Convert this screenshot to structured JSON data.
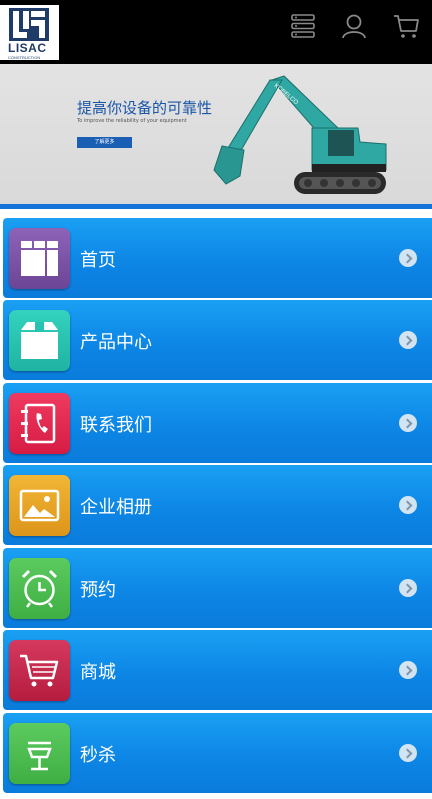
{
  "logo": {
    "name": "LISAC",
    "sub": "CONSTRUCTION"
  },
  "header_icons": [
    "list-icon",
    "user-icon",
    "cart-icon"
  ],
  "banner": {
    "title": "提高你设备的可靠性",
    "subtitle": "To improve the reliability of your equipment",
    "button": "了解更多",
    "brand_on_arm": "KOBELCO"
  },
  "menu": [
    {
      "label": "首页",
      "icon": "home-grid-icon",
      "color": "#7e54a8"
    },
    {
      "label": "产品中心",
      "icon": "box-icon",
      "color": "#25c3b0"
    },
    {
      "label": "联系我们",
      "icon": "phone-book-icon",
      "color": "#e8254f"
    },
    {
      "label": "企业相册",
      "icon": "photo-icon",
      "color": "#e9a722"
    },
    {
      "label": "预约",
      "icon": "alarm-clock-icon",
      "color": "#4bbb4f"
    },
    {
      "label": "商城",
      "icon": "shopping-cart-icon",
      "color": "#c8244a"
    },
    {
      "label": "秒杀",
      "icon": "flash-sale-icon",
      "color": "#4bbb4f"
    }
  ]
}
